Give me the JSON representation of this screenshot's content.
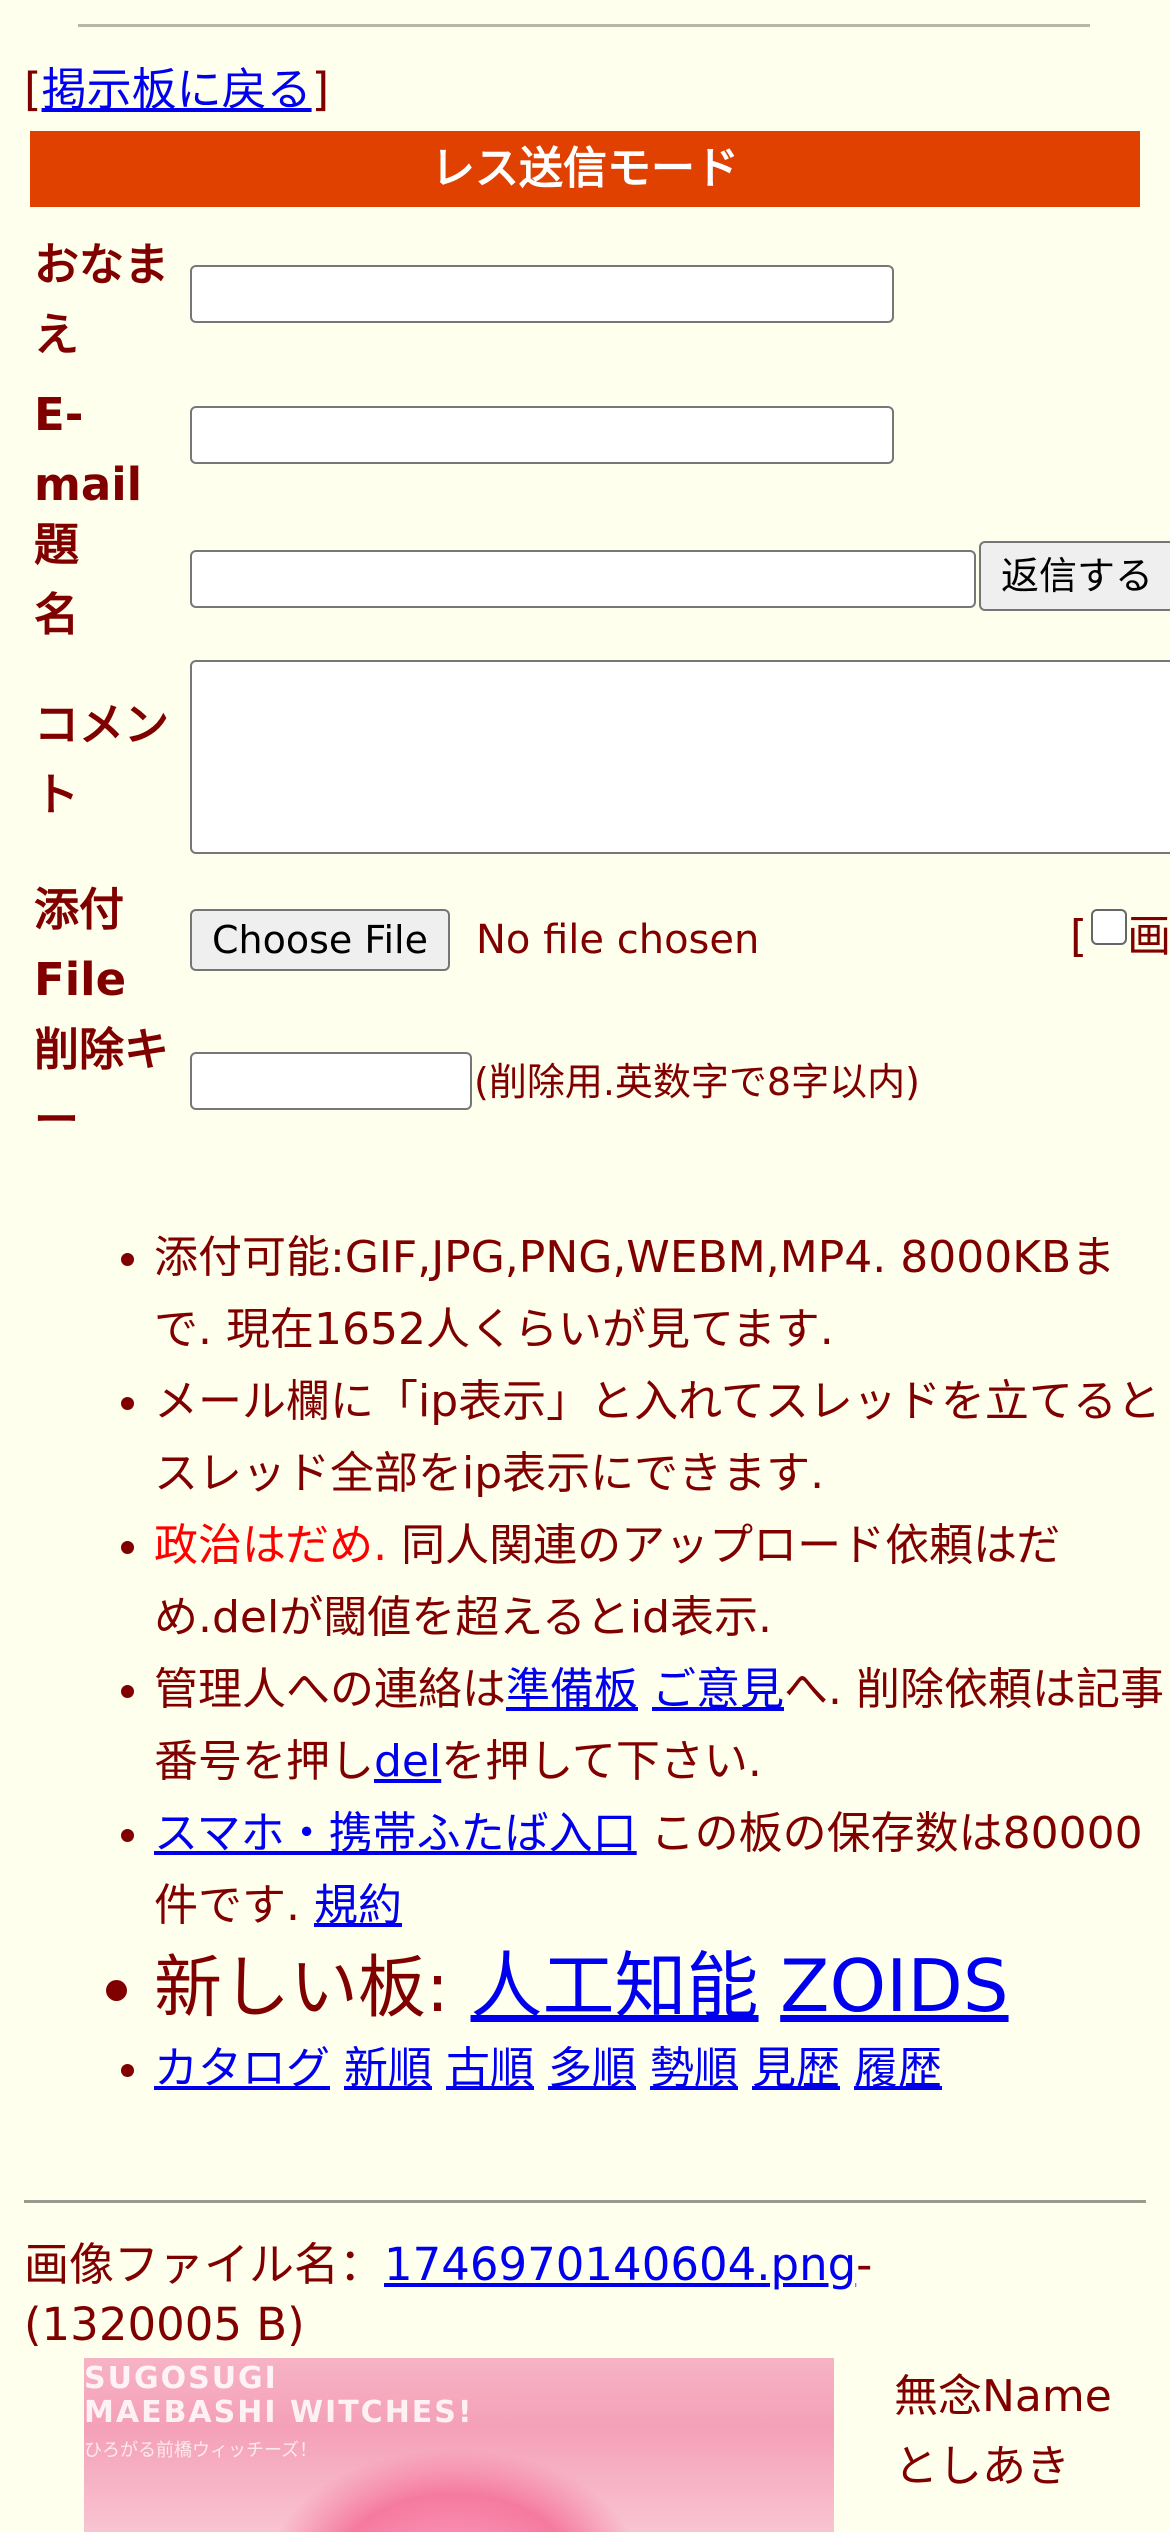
{
  "nav": {
    "back_label": "掲示板に戻る",
    "bracket_open": "[",
    "bracket_close": "]"
  },
  "form": {
    "mode_title": "レス送信モード",
    "name_label": "おなまえ",
    "email_label": "E-mail",
    "subject_label": "題名",
    "submit_label": "返信する",
    "comment_label": "コメント",
    "file_label": "添付File",
    "choose_file_label": "Choose File",
    "no_file_text": "No file chosen",
    "image_option_prefix": "[",
    "image_option_label": "画",
    "delkey_label": "削除キー",
    "delkey_hint": "(削除用.英数字で8字以内)"
  },
  "rules": {
    "r1": "添付可能:GIF,JPG,PNG,WEBM,MP4. 8000KBまで. 現在1652人くらいが見てます.",
    "r2": "メール欄に「ip表示」と入れてスレッドを立てるとスレッド全部をip表示にできます.",
    "r3_red": "政治はだめ.",
    "r3_rest": " 同人関連のアップロード依頼はだめ.delが閾値を超えるとid表示.",
    "r4_a": "管理人への連絡は",
    "r4_link1": "準備板",
    "r4_link2": "ご意見",
    "r4_b": "へ. 削除依頼は記事番号を押し",
    "r4_link3": "del",
    "r4_c": "を押して下さい.",
    "r5_link": "スマホ・携帯ふたば入口",
    "r5_a": " この板の保存数は80000件です. ",
    "r5_link2": "規約",
    "new_boards_label": "新しい板: ",
    "new_board_1": "人工知能",
    "new_board_2": "ZOIDS",
    "sort_links": [
      "カタログ",
      "新順",
      "古順",
      "多順",
      "勢順",
      "見歴",
      "履歴"
    ]
  },
  "post": {
    "file_prefix": "画像ファイル名：",
    "file_name": "1746970140604.png",
    "file_dash": "-",
    "file_size": "(1320005 B)",
    "thumb_title": "SUGOSUGI\nMAEBASHI WITCHES!",
    "thumb_sub": "ひろがる前橋ウィッチーズ！",
    "subject": "無念",
    "name_field": "Name",
    "name_value": "としあき"
  }
}
